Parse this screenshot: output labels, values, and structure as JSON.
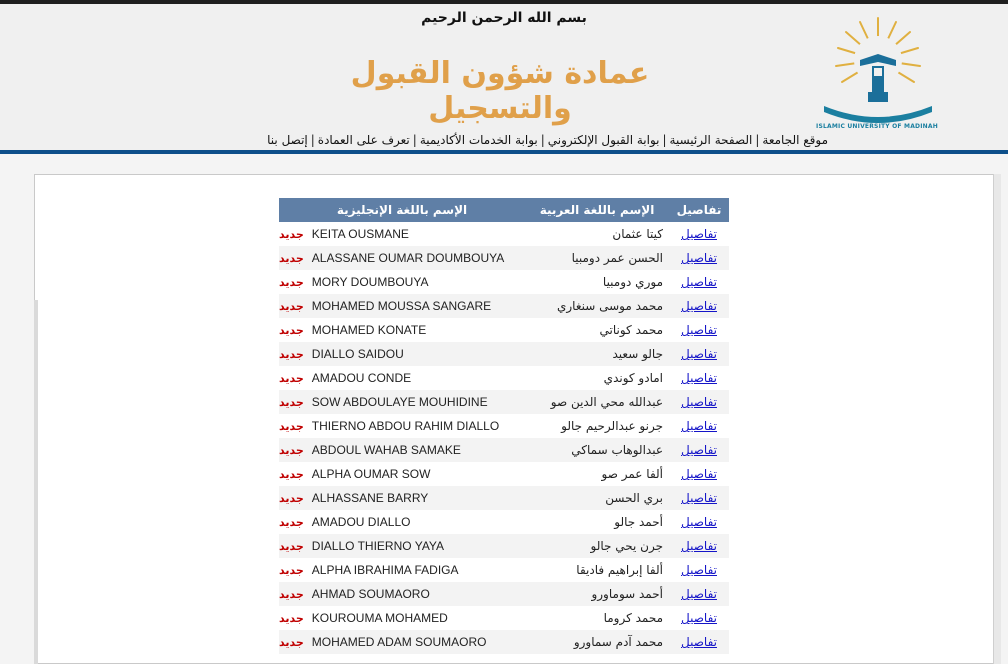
{
  "header": {
    "basmala": "بسم الله الرحمن الرحيم",
    "title": "عمادة شؤون القبول والتسجيل",
    "logo_text": "الجامعة الإسلامية بالمدينة المنورة",
    "logo_caption": "ISLAMIC UNIVERSITY OF MADINAH",
    "title_color": "#e0a04a"
  },
  "nav": {
    "items": [
      {
        "label": "موقع الجامعة"
      },
      {
        "label": "الصفحة الرئيسية"
      },
      {
        "label": "بوابة القبول الإلكتروني"
      },
      {
        "label": "بوابة الخدمات الأكاديمية"
      },
      {
        "label": "تعرف على العمادة"
      },
      {
        "label": "إتصل بنا"
      }
    ],
    "bar_color": "#0d4f8a"
  },
  "table": {
    "headers": {
      "details": "تفاصيل",
      "arabic_name": "الإسم باللغة العربية",
      "english_name": "الإسم باللغة الإنجليزية"
    },
    "header_color": "#5f7fa6",
    "details_link": "تفاصيل",
    "new_badge": "جديد",
    "rows": [
      {
        "ar": "كيتا عثمان",
        "en": "KEITA OUSMANE"
      },
      {
        "ar": "الحسن عمر دومبيا",
        "en": "ALASSANE OUMAR DOUMBOUYA"
      },
      {
        "ar": "موري دومبيا",
        "en": "MORY DOUMBOUYA"
      },
      {
        "ar": "محمد موسى سنغاري",
        "en": "MOHAMED MOUSSA SANGARE"
      },
      {
        "ar": "محمد كوناتي",
        "en": "MOHAMED KONATE"
      },
      {
        "ar": "جالو سعيد",
        "en": "DIALLO SAIDOU"
      },
      {
        "ar": "امادو كوندي",
        "en": "AMADOU CONDE"
      },
      {
        "ar": "عبدالله محي الدين صو",
        "en": "SOW ABDOULAYE MOUHIDINE"
      },
      {
        "ar": "جرنو عبدالرحيم جالو",
        "en": "THIERNO ABDOU RAHIM DIALLO"
      },
      {
        "ar": "عبدالوهاب سماكي",
        "en": "ABDOUL WAHAB SAMAKE"
      },
      {
        "ar": "ألفا عمر صو",
        "en": "ALPHA OUMAR SOW"
      },
      {
        "ar": "بري الحسن",
        "en": "ALHASSANE BARRY"
      },
      {
        "ar": "أحمد جالو",
        "en": "AMADOU DIALLO"
      },
      {
        "ar": "جرن يحي جالو",
        "en": "DIALLO THIERNO YAYA"
      },
      {
        "ar": "ألفا إبراهيم فاديقا",
        "en": "ALPHA IBRAHIMA FADIGA"
      },
      {
        "ar": "أحمد سوماورو",
        "en": "AHMAD SOUMAORO"
      },
      {
        "ar": "محمد كروما",
        "en": "KOUROUMA MOHAMED"
      },
      {
        "ar": "محمد آدم سماورو",
        "en": "MOHAMED ADAM SOUMAORO"
      }
    ]
  }
}
